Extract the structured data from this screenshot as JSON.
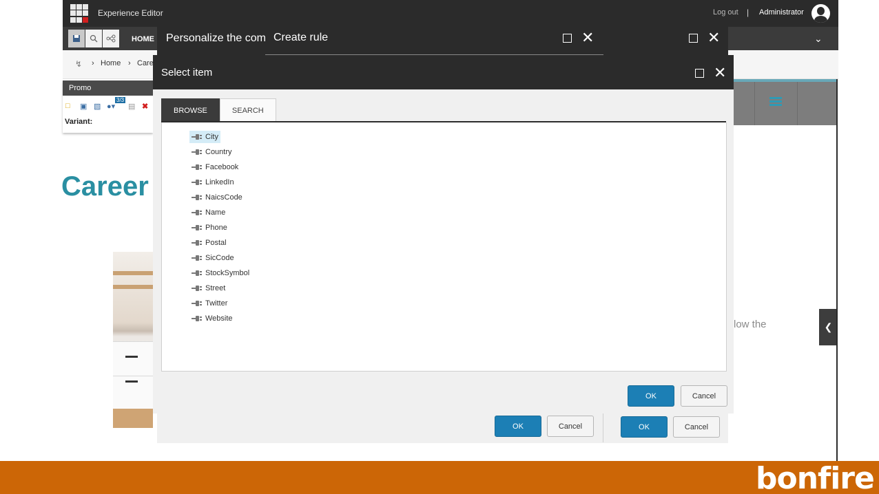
{
  "topbar": {
    "app_title": "Experience Editor",
    "logout": "Log out",
    "separator": "|",
    "user": "Administrator"
  },
  "ribbon": {
    "home_tab": "HOME"
  },
  "breadcrumb": {
    "items": [
      "Home",
      "Care"
    ]
  },
  "promo": {
    "header": "Promo",
    "badge": "3/3",
    "variant_label": "Variant:"
  },
  "page": {
    "heading": "Career",
    "body_fragment": "low the"
  },
  "personalize_dialog": {
    "title": "Personalize the com",
    "ok": "OK",
    "cancel": "Cancel"
  },
  "create_rule_dialog": {
    "title": "Create rule",
    "ok": "OK",
    "cancel": "Cancel"
  },
  "select_item_dialog": {
    "title": "Select item",
    "tabs": [
      "BROWSE",
      "SEARCH"
    ],
    "active_tab": "BROWSE",
    "items": [
      "City",
      "Country",
      "Facebook",
      "LinkedIn",
      "NaicsCode",
      "Name",
      "Phone",
      "Postal",
      "SicCode",
      "StockSymbol",
      "Street",
      "Twitter",
      "Website"
    ],
    "selected_item": "City",
    "ok": "OK",
    "cancel": "Cancel"
  },
  "footer": {
    "logo": "bonfire"
  },
  "colors": {
    "accent_blue": "#1c7fb5",
    "heading_teal": "#2a8fa2",
    "footer_orange": "#cc6606",
    "dialog_header": "#2b2b2b"
  }
}
